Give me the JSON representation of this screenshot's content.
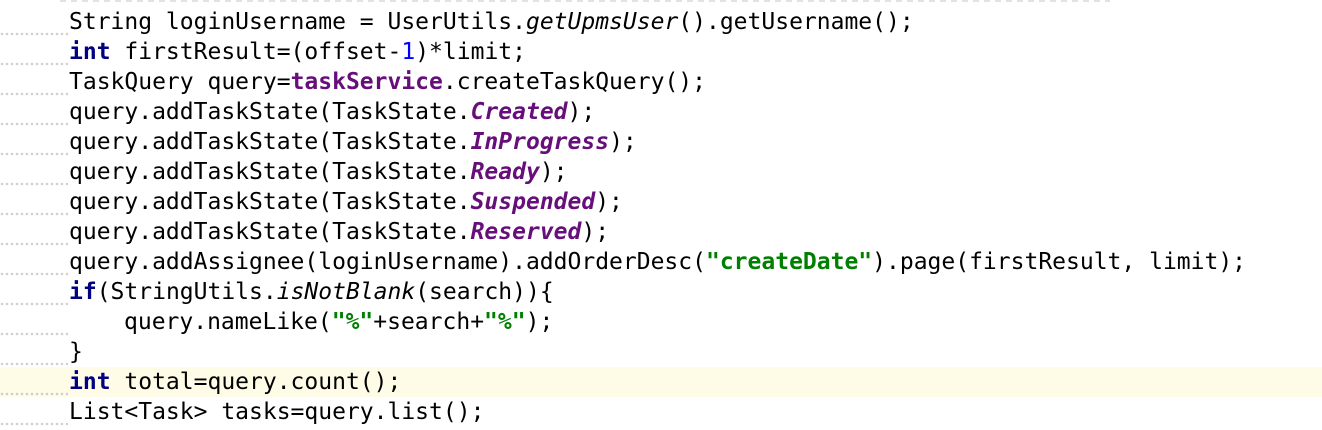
{
  "editor": {
    "lines": [
      [
        {
          "t": "String loginUsername = UserUtils.",
          "s": "plain"
        },
        {
          "t": "getUpmsUser",
          "s": "static"
        },
        {
          "t": "().getUsername();",
          "s": "plain"
        }
      ],
      [
        {
          "t": "int",
          "s": "kw"
        },
        {
          "t": " firstResult=(offset-",
          "s": "plain"
        },
        {
          "t": "1",
          "s": "num"
        },
        {
          "t": ")*limit;",
          "s": "plain"
        }
      ],
      [
        {
          "t": "TaskQuery query=",
          "s": "plain"
        },
        {
          "t": "taskService",
          "s": "field"
        },
        {
          "t": ".createTaskQuery();",
          "s": "plain"
        }
      ],
      [
        {
          "t": "query.addTaskState(TaskState.",
          "s": "plain"
        },
        {
          "t": "Created",
          "s": "enumc"
        },
        {
          "t": ");",
          "s": "plain"
        }
      ],
      [
        {
          "t": "query.addTaskState(TaskState.",
          "s": "plain"
        },
        {
          "t": "InProgress",
          "s": "enumc"
        },
        {
          "t": ");",
          "s": "plain"
        }
      ],
      [
        {
          "t": "query.addTaskState(TaskState.",
          "s": "plain"
        },
        {
          "t": "Ready",
          "s": "enumc"
        },
        {
          "t": ");",
          "s": "plain"
        }
      ],
      [
        {
          "t": "query.addTaskState(TaskState.",
          "s": "plain"
        },
        {
          "t": "Suspended",
          "s": "enumc"
        },
        {
          "t": ");",
          "s": "plain"
        }
      ],
      [
        {
          "t": "query.addTaskState(TaskState.",
          "s": "plain"
        },
        {
          "t": "Reserved",
          "s": "enumc"
        },
        {
          "t": ");",
          "s": "plain"
        }
      ],
      [
        {
          "t": "query.addAssignee(loginUsername).addOrderDesc(",
          "s": "plain"
        },
        {
          "t": "\"createDate\"",
          "s": "str"
        },
        {
          "t": ").page(firstResult, limit);",
          "s": "plain"
        }
      ],
      [
        {
          "t": "if",
          "s": "kw"
        },
        {
          "t": "(StringUtils.",
          "s": "plain"
        },
        {
          "t": "isNotBlank",
          "s": "static"
        },
        {
          "t": "(search)){",
          "s": "plain"
        }
      ],
      [
        {
          "t": "query.nameLike(",
          "s": "plain"
        },
        {
          "t": "\"%\"",
          "s": "str"
        },
        {
          "t": "+search+",
          "s": "plain"
        },
        {
          "t": "\"%\"",
          "s": "str"
        },
        {
          "t": ");",
          "s": "plain"
        }
      ],
      [
        {
          "t": "}",
          "s": "plain"
        }
      ],
      [
        {
          "t": "int",
          "s": "kw"
        },
        {
          "t": " total=query.count();",
          "s": "plain"
        }
      ],
      [
        {
          "t": "List<Task> tasks=query.list();",
          "s": "plain"
        }
      ]
    ],
    "indented_line": 10,
    "current_line": 12,
    "colors": {
      "background": "#ffffff",
      "current_line": "#fefbe7",
      "keyword": "#000080",
      "field": "#660e7a",
      "number": "#0000ff",
      "string": "#008000"
    }
  }
}
